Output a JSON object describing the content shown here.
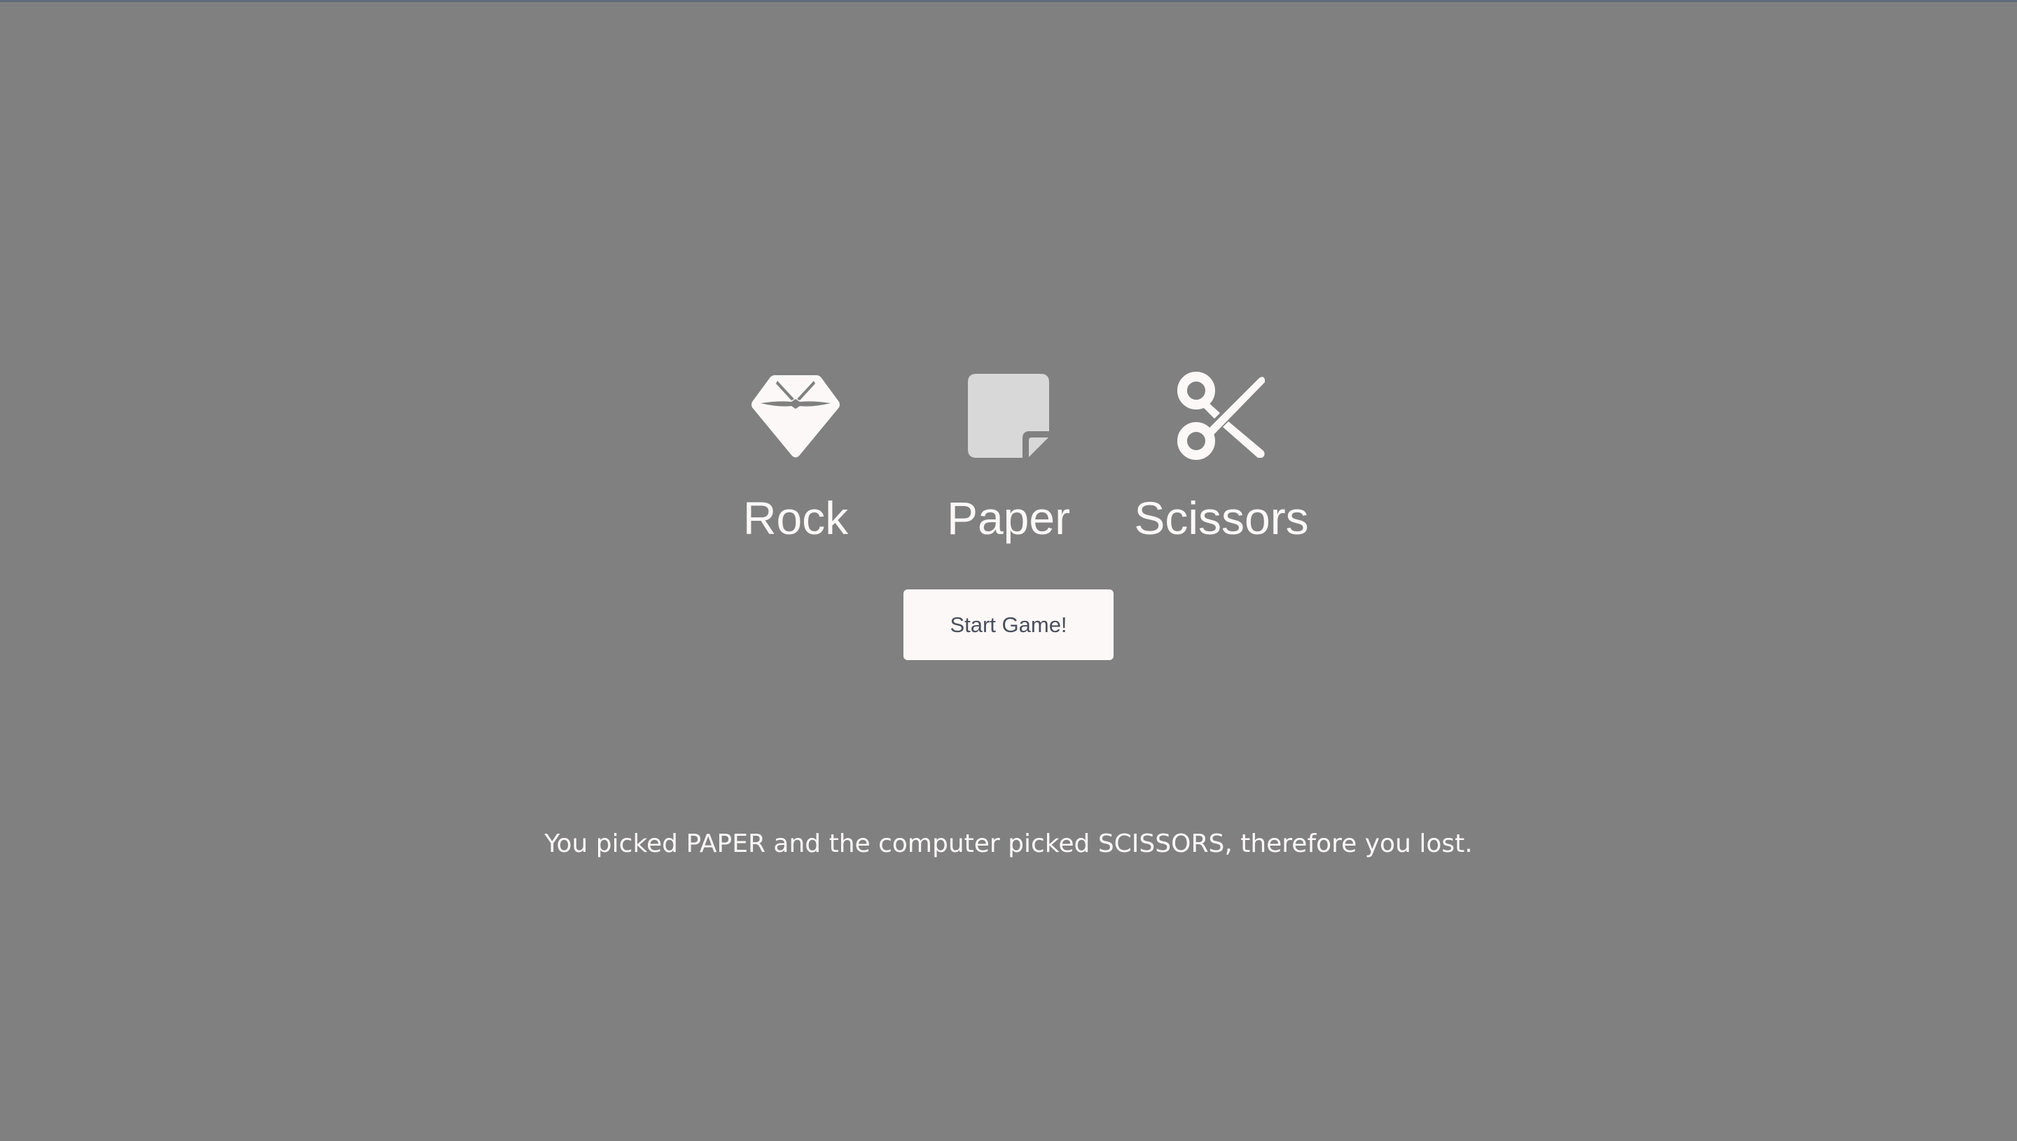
{
  "choices": [
    {
      "id": "rock",
      "label": "Rock",
      "icon": "gem-icon"
    },
    {
      "id": "paper",
      "label": "Paper",
      "icon": "note-icon"
    },
    {
      "id": "scissors",
      "label": "Scissors",
      "icon": "scissors-icon"
    }
  ],
  "start_button": {
    "label": "Start Game!"
  },
  "result": {
    "message": "You picked PAPER and the computer picked SCISSORS, therefore you lost."
  },
  "colors": {
    "background": "#808080",
    "text": "#fcf8f8",
    "button_background": "#fcf8f8",
    "button_text": "#4a4f5c",
    "paper_icon_fill": "#d8d8d8"
  }
}
